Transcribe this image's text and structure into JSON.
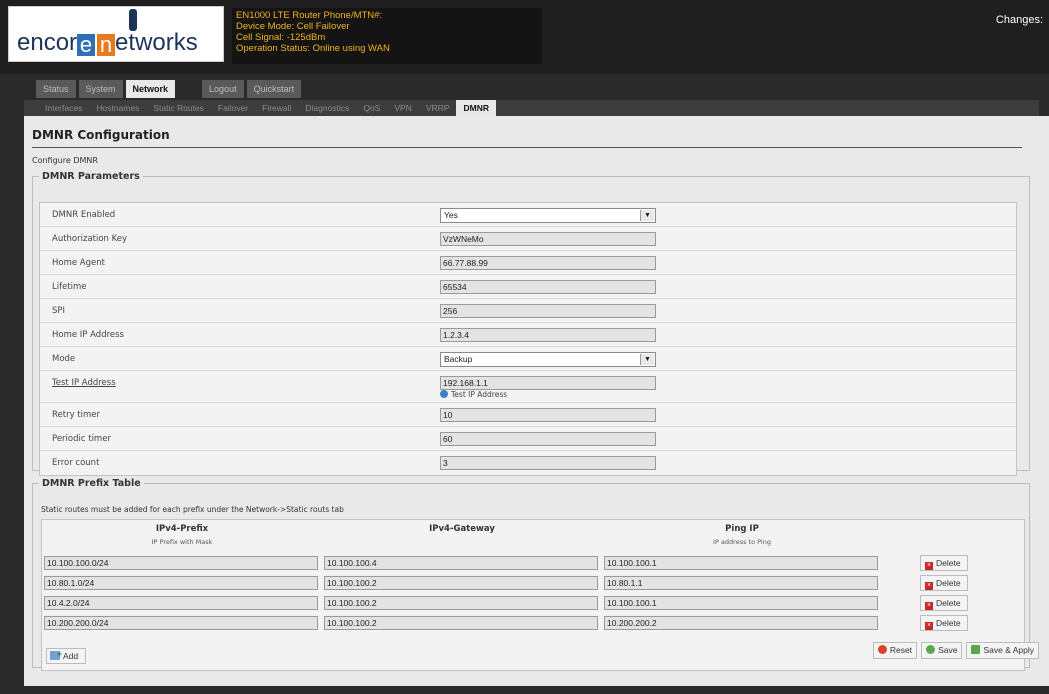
{
  "logo": {
    "prefix": "encor",
    "e_letter": "e",
    "n_letter": "n",
    "suffix": "etworks"
  },
  "device_info": {
    "line1": "EN1000 LTE Router Phone/MTN#:",
    "line2": "Device Mode: Cell Failover",
    "line3": "Cell Signal: -125dBm",
    "line4": "Operation Status: Online using WAN"
  },
  "changes_label": "Changes:",
  "main_tabs": [
    {
      "label": "Status"
    },
    {
      "label": "System"
    },
    {
      "label": "Network"
    },
    {
      "label": "Logout"
    },
    {
      "label": "Quickstart"
    }
  ],
  "sub_tabs": [
    {
      "label": "Interfaces"
    },
    {
      "label": "Hostnames"
    },
    {
      "label": "Static Routes"
    },
    {
      "label": "Failover"
    },
    {
      "label": "Firewall"
    },
    {
      "label": "Diagnostics"
    },
    {
      "label": "QoS"
    },
    {
      "label": "VPN"
    },
    {
      "label": "VRRP"
    },
    {
      "label": "DMNR"
    }
  ],
  "page": {
    "title": "DMNR Configuration",
    "description": "Configure DMNR"
  },
  "params": {
    "legend": "DMNR Parameters",
    "rows": [
      {
        "label": "DMNR Enabled",
        "value": "Yes"
      },
      {
        "label": "Authorization Key",
        "value": "VzWNeMo"
      },
      {
        "label": "Home Agent",
        "value": "66.77.88.99"
      },
      {
        "label": "Lifetime",
        "value": "65534"
      },
      {
        "label": "SPI",
        "value": "256"
      },
      {
        "label": "Home IP Address",
        "value": "1.2.3.4"
      },
      {
        "label": "Mode",
        "value": "Backup"
      },
      {
        "label": "Test IP Address",
        "value": "192.168.1.1",
        "note": "Test IP Address"
      },
      {
        "label": "Retry timer",
        "value": "10"
      },
      {
        "label": "Periodic timer",
        "value": "60"
      },
      {
        "label": "Error count",
        "value": "3"
      }
    ]
  },
  "prefix_table": {
    "legend": "DMNR Prefix Table",
    "note": "Static routes must be added for each prefix under the Network->Static routs tab",
    "headers": {
      "prefix": "IPv4-Prefix",
      "prefix_sub": "IP Prefix with Mask",
      "gateway": "IPv4-Gateway",
      "ping": "Ping IP",
      "ping_sub": "IP address to Ping"
    },
    "rows": [
      {
        "prefix": "10.100.100.0/24",
        "gateway": "10.100.100.4",
        "ping": "10.100.100.1"
      },
      {
        "prefix": "10.80.1.0/24",
        "gateway": "10.100.100.2",
        "ping": "10.80.1.1"
      },
      {
        "prefix": "10.4.2.0/24",
        "gateway": "10.100.100.2",
        "ping": "10.100.100.1"
      },
      {
        "prefix": "10.200.200.0/24",
        "gateway": "10.100.100.2",
        "ping": "10.200.200.2"
      }
    ],
    "delete_label": "Delete",
    "add_label": "Add"
  },
  "actions": {
    "reset": "Reset",
    "save": "Save",
    "save_apply": "Save & Apply"
  }
}
